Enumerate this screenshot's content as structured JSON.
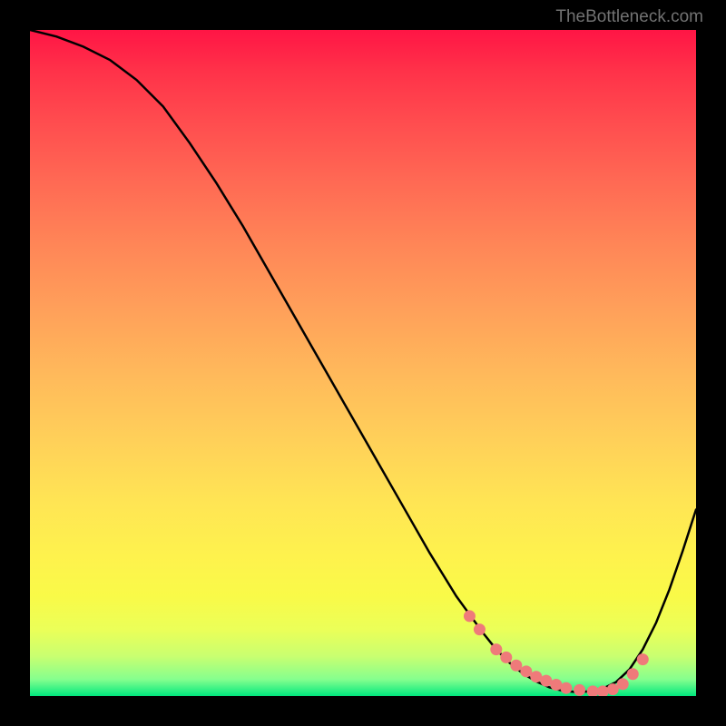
{
  "watermark": "TheBottleneck.com",
  "chart_data": {
    "type": "line",
    "title": "",
    "xlabel": "",
    "ylabel": "",
    "xlim": [
      0,
      100
    ],
    "ylim": [
      0,
      100
    ],
    "grid": false,
    "legend": false,
    "series": [
      {
        "name": "curve",
        "x": [
          0,
          4,
          8,
          12,
          16,
          20,
          24,
          28,
          32,
          36,
          40,
          44,
          48,
          52,
          56,
          60,
          64,
          68,
          70,
          72,
          74,
          76,
          78,
          80,
          82,
          84,
          86,
          88,
          90,
          92,
          94,
          96,
          98,
          100
        ],
        "y": [
          100,
          99.0,
          97.5,
          95.5,
          92.5,
          88.5,
          83.0,
          77.0,
          70.5,
          63.5,
          56.5,
          49.5,
          42.5,
          35.5,
          28.5,
          21.5,
          15.0,
          9.5,
          7.0,
          5.0,
          3.4,
          2.2,
          1.3,
          0.8,
          0.6,
          0.7,
          1.1,
          2.1,
          4.0,
          7.0,
          11.0,
          16.0,
          21.8,
          28.0
        ]
      }
    ],
    "markers": {
      "name": "highlight-points",
      "color": "#ef7a7a",
      "x": [
        66,
        67.5,
        70,
        71.5,
        73,
        74.5,
        76,
        77.5,
        79,
        80.5,
        82.5,
        84.5,
        86,
        87.5,
        89,
        90.5,
        92
      ],
      "y": [
        12.0,
        10.0,
        7.0,
        5.8,
        4.6,
        3.7,
        2.9,
        2.3,
        1.7,
        1.2,
        0.9,
        0.7,
        0.7,
        1.0,
        1.8,
        3.3,
        5.5
      ]
    }
  }
}
